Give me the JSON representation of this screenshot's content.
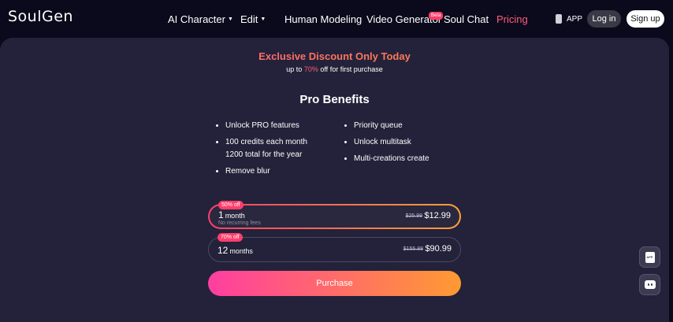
{
  "nav": {
    "logo": "SoulGen",
    "items": [
      {
        "label": "AI Character",
        "has_caret": true
      },
      {
        "label": "Edit",
        "has_caret": true
      },
      {
        "label": "Human Modeling"
      },
      {
        "label": "Video Generator",
        "badge": "Beta"
      },
      {
        "label": "Soul Chat"
      },
      {
        "label": "Pricing",
        "active": true
      }
    ],
    "app_label": "APP",
    "login_label": "Log in",
    "signup_label": "Sign up"
  },
  "promo": {
    "title": "Exclusive Discount Only Today",
    "sub_prefix": "up to",
    "sub_highlight": "70%",
    "sub_suffix": "off for first purchase"
  },
  "benefits": {
    "title": "Pro Benefits",
    "left": [
      "Unlock PRO features",
      "100 credits each month",
      "1200 total for the year",
      "Remove blur"
    ],
    "right": [
      "Priority queue",
      "Unlock multitask",
      "Multi-creations create"
    ]
  },
  "plans": [
    {
      "badge": "50% off",
      "term": "1",
      "unit": "month",
      "note": "No recurring fees",
      "old_price": "$25.99",
      "new_price": "$12.99",
      "selected": true
    },
    {
      "badge": "70% off",
      "term": "12",
      "unit": "months",
      "note": "",
      "old_price": "$155.88",
      "new_price": "$90.99",
      "selected": false
    }
  ],
  "purchase_label": "Purchase",
  "float": {
    "app_icon_text": "APP"
  },
  "colors": {
    "background": "#0b0a1c",
    "panel": "#23223a",
    "accent_pink": "#ff3e6c",
    "accent_orange": "#ff9a32",
    "active_nav": "#ff5c7a"
  },
  "icons": [
    "phone-icon",
    "chevron-down-icon",
    "app-download-icon",
    "chat-bot-icon"
  ]
}
